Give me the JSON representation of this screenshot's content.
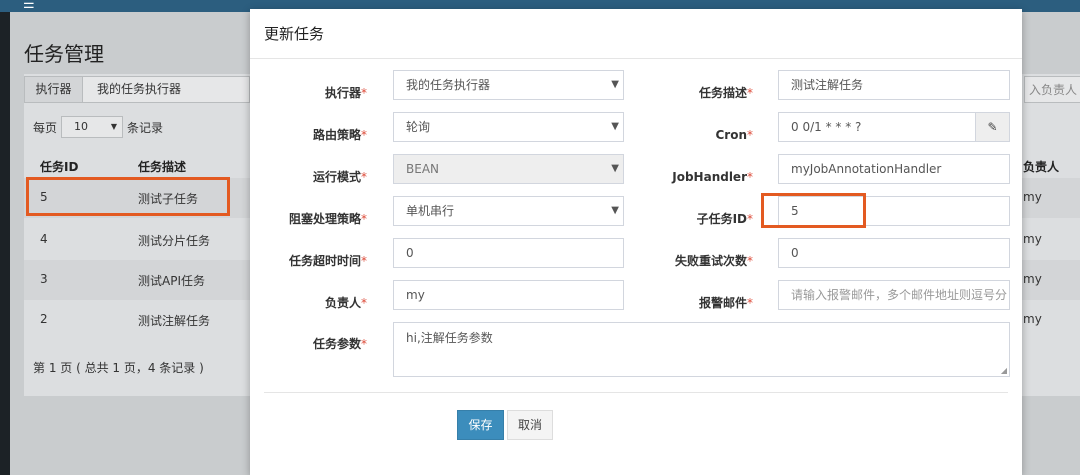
{
  "app": {
    "menu_icon": "☰",
    "page_title": "任务管理",
    "filter": {
      "label": "执行器",
      "value": "我的任务执行器"
    },
    "right_placeholder": "入负责人",
    "page_size": {
      "prefix": "每页",
      "value": "10",
      "suffix": "条记录"
    },
    "table": {
      "headers": {
        "id": "任务ID",
        "desc": "任务描述",
        "owner": "负责人"
      },
      "rows": [
        {
          "id": "5",
          "desc": "测试子任务",
          "owner": "my"
        },
        {
          "id": "4",
          "desc": "测试分片任务",
          "owner": "my"
        },
        {
          "id": "3",
          "desc": "测试API任务",
          "owner": "my"
        },
        {
          "id": "2",
          "desc": "测试注解任务",
          "owner": "my"
        }
      ]
    },
    "pager": "第 1 页 ( 总共 1 页，4 条记录 )"
  },
  "modal": {
    "title": "更新任务",
    "fields": {
      "executor": {
        "label": "执行器",
        "value": "我的任务执行器"
      },
      "route": {
        "label": "路由策略",
        "value": "轮询"
      },
      "run_mode": {
        "label": "运行模式",
        "value": "BEAN"
      },
      "block": {
        "label": "阻塞处理策略",
        "value": "单机串行"
      },
      "timeout": {
        "label": "任务超时时间",
        "value": "0"
      },
      "owner": {
        "label": "负责人",
        "value": "my"
      },
      "params": {
        "label": "任务参数",
        "value": "hi,注解任务参数"
      },
      "desc": {
        "label": "任务描述",
        "value": "测试注解任务"
      },
      "cron": {
        "label": "Cron",
        "value": "0 0/1 * * * ?"
      },
      "handler": {
        "label": "JobHandler",
        "value": "myJobAnnotationHandler"
      },
      "child": {
        "label": "子任务ID",
        "value": "5"
      },
      "retry": {
        "label": "失败重试次数",
        "value": "0"
      },
      "alarm": {
        "label": "报警邮件",
        "placeholder": "请输入报警邮件，多个邮件地址则逗号分"
      }
    },
    "required_mark": "*",
    "save_label": "保存",
    "cancel_label": "取消"
  },
  "colors": {
    "primary": "#3c8dbc",
    "highlight": "#e35a21",
    "required": "#dd4b39"
  },
  "icons": {
    "menu": "hamburger-menu-icon",
    "cron": "edit-icon"
  }
}
